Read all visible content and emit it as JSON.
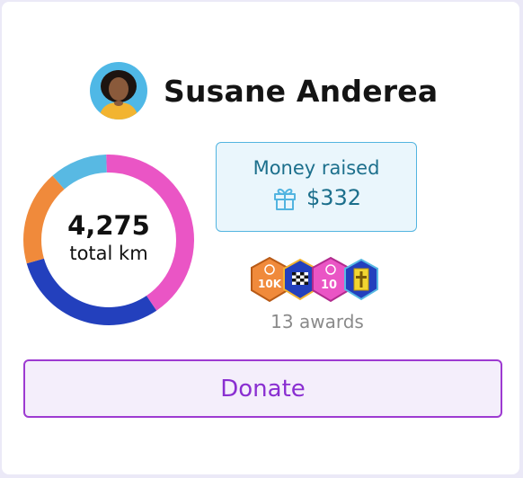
{
  "profile": {
    "name": "Susane Anderea",
    "avatar_icon": "avatar-photo"
  },
  "distance": {
    "value": "4,275",
    "label": "total km",
    "segments": [
      {
        "color": "#58b9e3",
        "fraction": 0.11
      },
      {
        "color": "#ea55c5",
        "fraction": 0.41
      },
      {
        "color": "#2340bd",
        "fraction": 0.3
      },
      {
        "color": "#f08a3b",
        "fraction": 0.18
      }
    ]
  },
  "money": {
    "label": "Money raised",
    "amount": "$332",
    "icon": "gift-icon"
  },
  "awards": {
    "count_label": "13 awards",
    "badges": [
      "10K",
      "checkered-flag",
      "10",
      "cross"
    ]
  },
  "donate": {
    "label": "Donate"
  },
  "colors": {
    "accent": "#8a2fd1",
    "money_border": "#52b4e0",
    "money_text": "#1c6f8c"
  }
}
